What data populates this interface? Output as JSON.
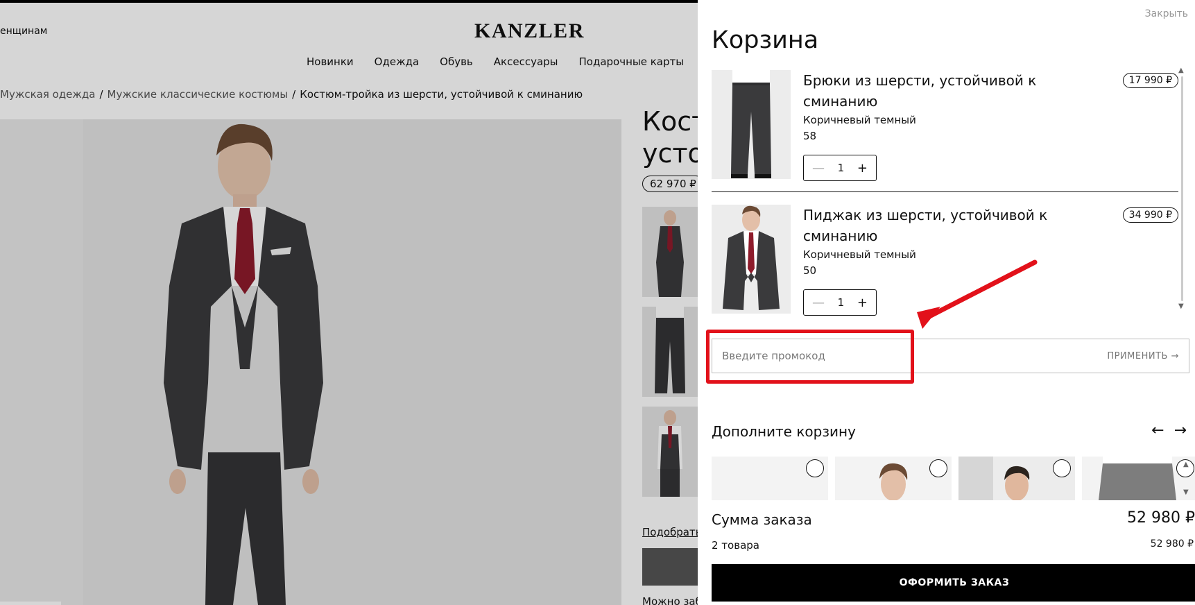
{
  "site": {
    "logo": "KANZLER",
    "women_link": "енщинам",
    "nav": [
      "Новинки",
      "Одежда",
      "Обувь",
      "Аксессуары",
      "Подарочные карты"
    ],
    "breadcrumb": [
      {
        "label": "Мужская одежда",
        "link": true
      },
      {
        "label": "Мужские классические костюмы",
        "link": true
      },
      {
        "label": "Костюм-тройка из шерсти, устойчивой к сминанию",
        "link": false
      }
    ],
    "product_title_line1": "Кост",
    "product_title_line2": "усто",
    "product_price": "62 970 ₽",
    "pick_link": "Подобрать",
    "can_text": "Можно заб"
  },
  "cart": {
    "close_label": "Закрыть",
    "title": "Корзина",
    "items": [
      {
        "name": "Брюки из шерсти, устойчивой к сминанию",
        "color": "Коричневый темный",
        "size": "58",
        "qty": "1",
        "price": "17 990 ₽",
        "image_icon": "trousers-photo"
      },
      {
        "name": "Пиджак из шерсти, устойчивой к сминанию",
        "color": "Коричневый темный",
        "size": "50",
        "qty": "1",
        "price": "34 990 ₽",
        "image_icon": "jacket-photo"
      }
    ],
    "qty_minus": "—",
    "qty_plus": "+",
    "promo": {
      "placeholder": "Введите промокод",
      "apply_label": "ПРИМЕНИТЬ →"
    },
    "addons_title": "Дополните корзину",
    "addons_prev": "←",
    "addons_next": "→",
    "sum_label": "Сумма заказа",
    "sum_value": "52 980 ₽",
    "count_label": "2 товара",
    "count_value": "52 980 ₽",
    "checkout_label": "ОФОРМИТЬ ЗАКАЗ"
  },
  "annotation": {
    "color": "#e2111a"
  },
  "colors": {
    "suit": "#3a3a3c",
    "tie": "#8e1b2b",
    "shirt": "#ffffff",
    "accent_black": "#000000"
  }
}
